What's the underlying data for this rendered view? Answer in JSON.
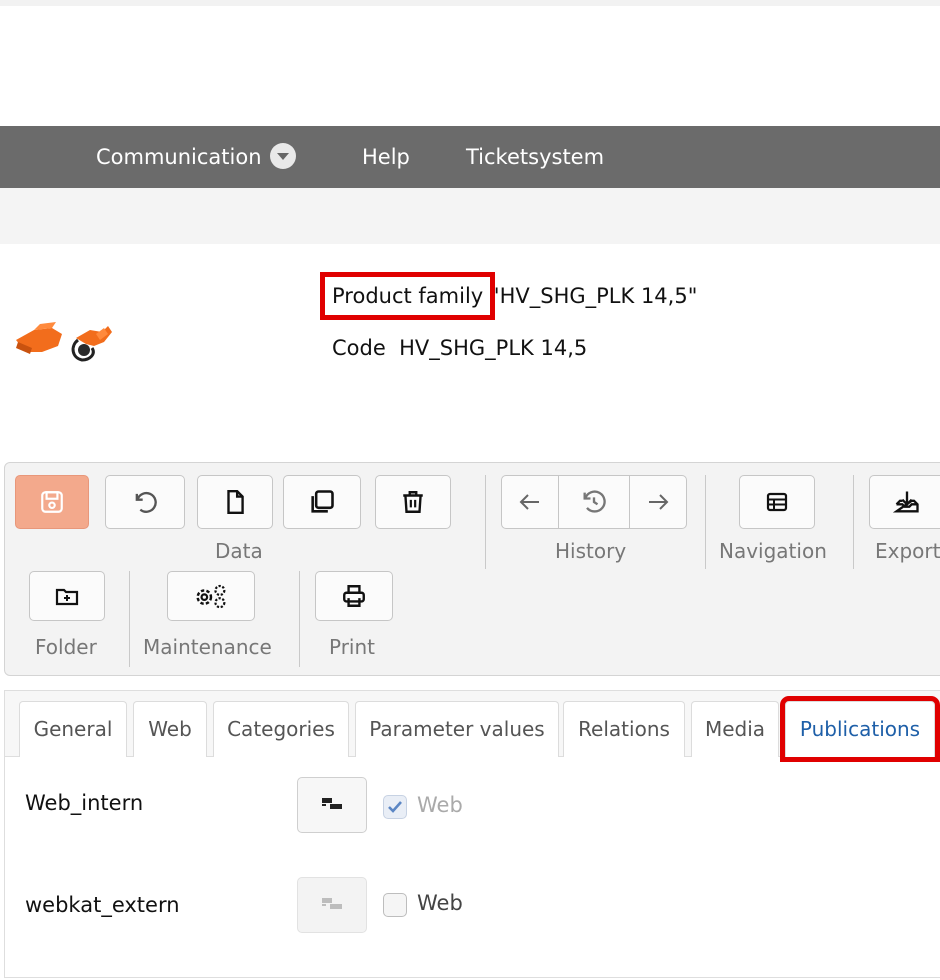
{
  "nav": {
    "items": [
      {
        "label": "Communication",
        "has_dropdown": true
      },
      {
        "label": "Help",
        "has_dropdown": false
      },
      {
        "label": "Ticketsystem",
        "has_dropdown": false
      }
    ]
  },
  "product": {
    "family_label": "Product family",
    "family_value": "\"HV_SHG_PLK 14,5\"",
    "code_label": "Code",
    "code_value": "HV_SHG_PLK 14,5"
  },
  "toolbar": {
    "groups": {
      "data": "Data",
      "history": "History",
      "navigation": "Navigation",
      "export": "Export",
      "folder": "Folder",
      "maintenance": "Maintenance",
      "print": "Print"
    }
  },
  "tabs": {
    "items": [
      "General",
      "Web",
      "Categories",
      "Parameter values",
      "Relations",
      "Media",
      "Publications"
    ],
    "active": "Publications"
  },
  "publications": {
    "rows": [
      {
        "name": "Web_intern",
        "checkbox_label": "Web",
        "checked": true,
        "enabled": false
      },
      {
        "name": "webkat_extern",
        "checkbox_label": "Web",
        "checked": false,
        "enabled": true
      }
    ]
  },
  "colors": {
    "navbar_bg": "#6b6b6b",
    "highlight_red": "#e00000",
    "active_tab_text": "#1e5fa8",
    "save_button_bg": "#f3a98c",
    "product_orange": "#f26d1c"
  }
}
